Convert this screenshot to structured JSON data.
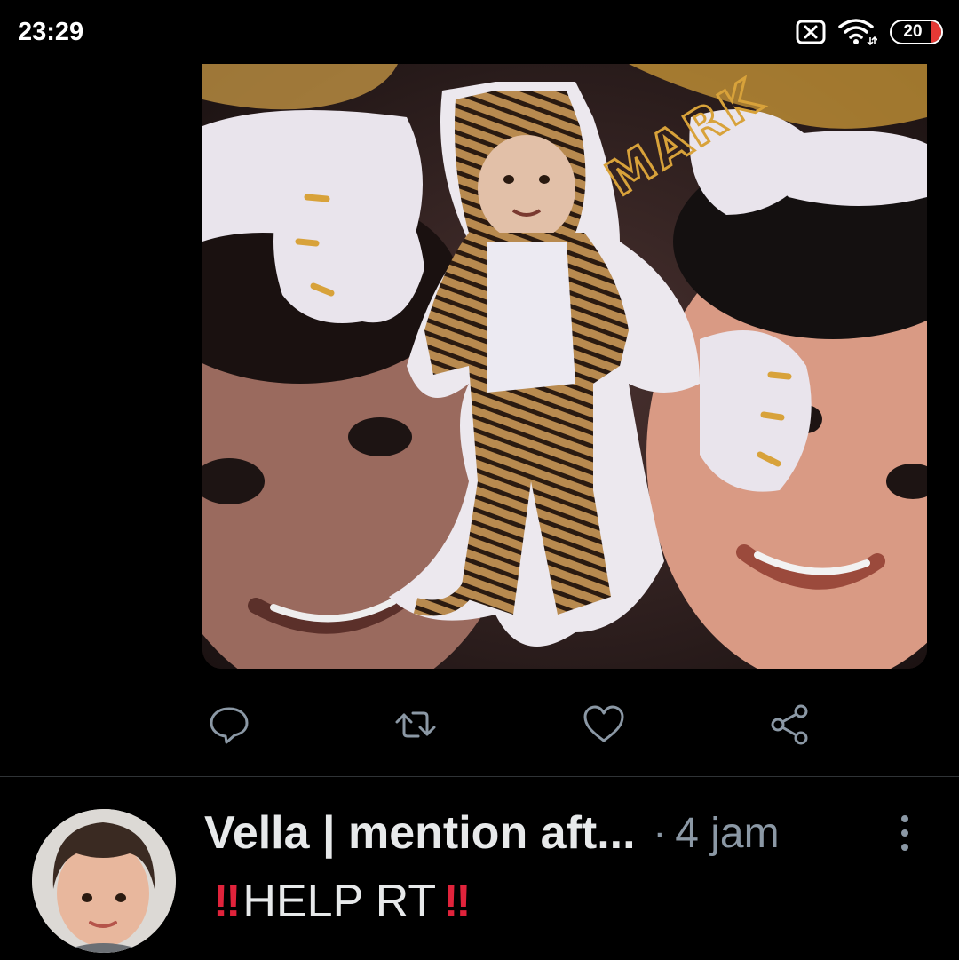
{
  "status_bar": {
    "time": "23:29",
    "battery": "20",
    "icons": [
      "sim-off-icon",
      "wifi-icon",
      "battery-icon"
    ]
  },
  "media": {
    "sticker_label": "MARK",
    "colors": {
      "sticker": "#ece8ee",
      "fur": "#b88a4f",
      "skin": "#d99a84",
      "accent": "#d8a23a"
    }
  },
  "actions": {
    "icons": [
      "reply-icon",
      "retweet-icon",
      "like-icon",
      "share-icon"
    ],
    "color": "#8b98a5"
  },
  "next_tweet": {
    "author": "Vella | mention aft...",
    "separator": "·",
    "time": "4 jam",
    "text_prefix": "‼",
    "text": "HELP RT",
    "text_suffix": "‼",
    "more_icon": "more-vertical-icon"
  }
}
